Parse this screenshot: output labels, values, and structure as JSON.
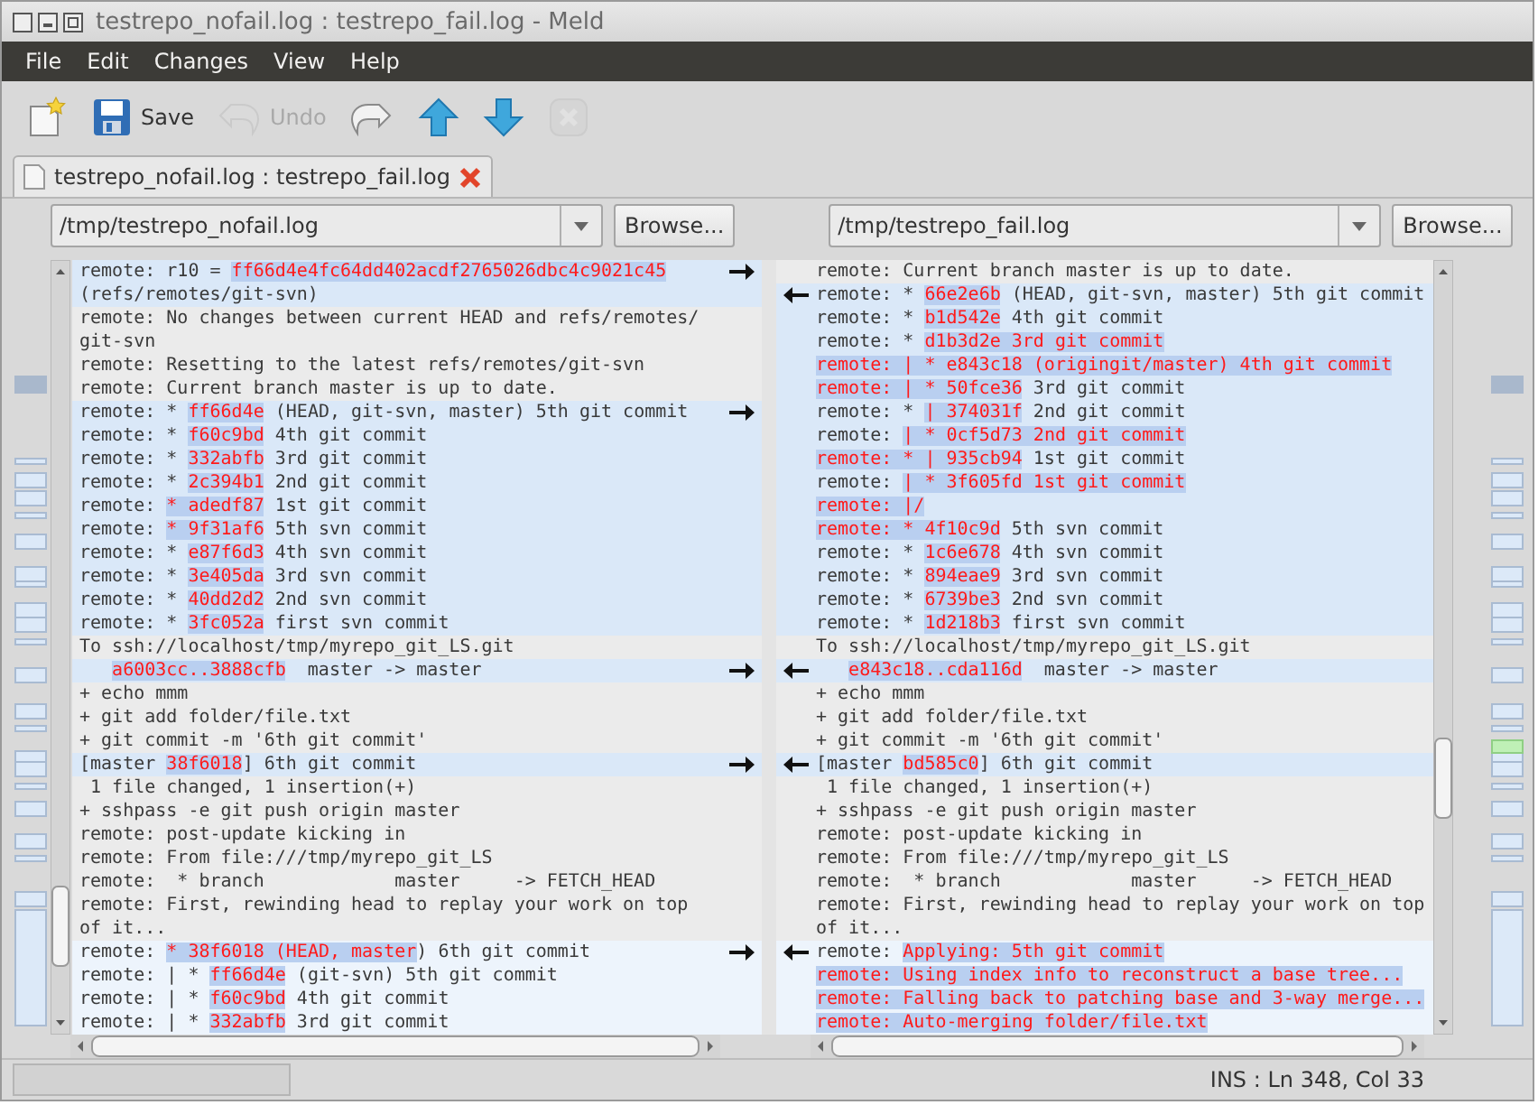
{
  "window": {
    "title": "testrepo_nofail.log : testrepo_fail.log - Meld"
  },
  "menu": [
    "File",
    "Edit",
    "Changes",
    "View",
    "Help"
  ],
  "toolbar": [
    {
      "kind": "new",
      "disabled": false
    },
    {
      "kind": "save",
      "label": "Save",
      "disabled": false
    },
    {
      "kind": "undo",
      "label": "Undo",
      "disabled": true
    },
    {
      "kind": "redo",
      "disabled": false
    },
    {
      "kind": "up",
      "disabled": false
    },
    {
      "kind": "down",
      "disabled": false
    },
    {
      "kind": "stop",
      "disabled": true
    }
  ],
  "tabs": [
    {
      "label": "testrepo_nofail.log : testrepo_fail.log",
      "selected": true
    }
  ],
  "panes": [
    {
      "path": "/tmp/testrepo_nofail.log",
      "browse": "Browse...",
      "lines": [
        {
          "kind": "changed",
          "arrow": true,
          "parts": [
            {
              "text": "remote: r10 = ",
              "changed": false
            },
            {
              "text": "ff66d4e4fc64dd402acdf2765026dbc4c9021c45",
              "changed": true
            }
          ]
        },
        {
          "kind": "changed",
          "arrow": false,
          "parts": [
            {
              "text": "(refs/remotes/git-svn)",
              "changed": false
            }
          ]
        },
        {
          "kind": "equal",
          "arrow": false,
          "parts": [
            {
              "text": "remote: No changes between current HEAD and refs/remotes/",
              "changed": false
            }
          ]
        },
        {
          "kind": "equal",
          "arrow": false,
          "parts": [
            {
              "text": "git-svn",
              "changed": false
            }
          ]
        },
        {
          "kind": "equal",
          "arrow": false,
          "parts": [
            {
              "text": "remote: Resetting to the latest refs/remotes/git-svn",
              "changed": false
            }
          ]
        },
        {
          "kind": "equal",
          "arrow": false,
          "parts": [
            {
              "text": "remote: Current branch master is up to date.",
              "changed": false
            }
          ]
        },
        {
          "kind": "changed",
          "arrow": true,
          "parts": [
            {
              "text": "remote: * ",
              "changed": false
            },
            {
              "text": "ff66d4e",
              "changed": true
            },
            {
              "text": " (HEAD, git-svn, master) 5th git commit",
              "changed": false
            }
          ]
        },
        {
          "kind": "changed",
          "arrow": false,
          "parts": [
            {
              "text": "remote: * ",
              "changed": false
            },
            {
              "text": "f60c9bd",
              "changed": true
            },
            {
              "text": " 4th git commit",
              "changed": false
            }
          ]
        },
        {
          "kind": "changed",
          "arrow": false,
          "parts": [
            {
              "text": "remote: * ",
              "changed": false
            },
            {
              "text": "332abfb",
              "changed": true
            },
            {
              "text": " 3rd git commit",
              "changed": false
            }
          ]
        },
        {
          "kind": "changed",
          "arrow": false,
          "parts": [
            {
              "text": "remote: * ",
              "changed": false
            },
            {
              "text": "2c394b1",
              "changed": true
            },
            {
              "text": " 2nd git commit",
              "changed": false
            }
          ]
        },
        {
          "kind": "changed",
          "arrow": false,
          "parts": [
            {
              "text": "remote: ",
              "changed": false
            },
            {
              "text": "* adedf87",
              "changed": true
            },
            {
              "text": " 1st git commit",
              "changed": false
            }
          ]
        },
        {
          "kind": "changed",
          "arrow": false,
          "parts": [
            {
              "text": "remote: ",
              "changed": false
            },
            {
              "text": "* 9f31af6",
              "changed": true
            },
            {
              "text": " 5th svn commit",
              "changed": false
            }
          ]
        },
        {
          "kind": "changed",
          "arrow": false,
          "parts": [
            {
              "text": "remote: * ",
              "changed": false
            },
            {
              "text": "e87f6d3",
              "changed": true
            },
            {
              "text": " 4th svn commit",
              "changed": false
            }
          ]
        },
        {
          "kind": "changed",
          "arrow": false,
          "parts": [
            {
              "text": "remote: * ",
              "changed": false
            },
            {
              "text": "3e405da",
              "changed": true
            },
            {
              "text": " 3rd svn commit",
              "changed": false
            }
          ]
        },
        {
          "kind": "changed",
          "arrow": false,
          "parts": [
            {
              "text": "remote: * ",
              "changed": false
            },
            {
              "text": "40dd2d2",
              "changed": true
            },
            {
              "text": " 2nd svn commit",
              "changed": false
            }
          ]
        },
        {
          "kind": "changed",
          "arrow": false,
          "parts": [
            {
              "text": "remote: * ",
              "changed": false
            },
            {
              "text": "3fc052a",
              "changed": true
            },
            {
              "text": " first svn commit",
              "changed": false
            }
          ]
        },
        {
          "kind": "equal",
          "arrow": false,
          "parts": [
            {
              "text": "To ssh://localhost/tmp/myrepo_git_LS.git",
              "changed": false
            }
          ]
        },
        {
          "kind": "changed",
          "arrow": true,
          "indented": true,
          "parts": [
            {
              "text": "a6003cc..3888cfb",
              "changed": true
            },
            {
              "text": "  master -> master",
              "changed": false
            }
          ]
        },
        {
          "kind": "equal",
          "arrow": false,
          "parts": [
            {
              "text": "+ echo mmm",
              "changed": false
            }
          ]
        },
        {
          "kind": "equal",
          "arrow": false,
          "parts": [
            {
              "text": "+ git add folder/file.txt",
              "changed": false
            }
          ]
        },
        {
          "kind": "equal",
          "arrow": false,
          "parts": [
            {
              "text": "+ git commit -m '6th git commit'",
              "changed": false
            }
          ]
        },
        {
          "kind": "changed",
          "arrow": true,
          "parts": [
            {
              "text": "[master ",
              "changed": false
            },
            {
              "text": "38f6018",
              "changed": true
            },
            {
              "text": "] 6th git commit",
              "changed": false
            }
          ]
        },
        {
          "kind": "equal",
          "arrow": false,
          "parts": [
            {
              "text": " 1 file changed, 1 insertion(+)",
              "changed": false
            }
          ]
        },
        {
          "kind": "equal",
          "arrow": false,
          "parts": [
            {
              "text": "+ sshpass -e git push origin master",
              "changed": false
            }
          ]
        },
        {
          "kind": "equal",
          "arrow": false,
          "parts": [
            {
              "text": "remote: post-update kicking in",
              "changed": false
            }
          ]
        },
        {
          "kind": "equal",
          "arrow": false,
          "parts": [
            {
              "text": "remote: From file:///tmp/myrepo_git_LS",
              "changed": false
            }
          ]
        },
        {
          "kind": "equal",
          "arrow": false,
          "parts": [
            {
              "text": "remote:  * branch            master     -> FETCH_HEAD",
              "changed": false
            }
          ]
        },
        {
          "kind": "equal",
          "arrow": false,
          "parts": [
            {
              "text": "remote: First, rewinding head to replay your work on top",
              "changed": false
            }
          ]
        },
        {
          "kind": "equal",
          "arrow": false,
          "parts": [
            {
              "text": "of it...",
              "changed": false
            }
          ]
        },
        {
          "kind": "inserted",
          "arrow": true,
          "parts": [
            {
              "text": "remote: ",
              "changed": false
            },
            {
              "text": "* 38f6018 (HEAD, master",
              "changed": true
            },
            {
              "text": ") 6th git commit",
              "changed": false
            }
          ]
        },
        {
          "kind": "inserted",
          "arrow": false,
          "parts": [
            {
              "text": "remote: | * ",
              "changed": false
            },
            {
              "text": "ff66d4e",
              "changed": true
            },
            {
              "text": " (git-svn) 5th git commit",
              "changed": false
            }
          ]
        },
        {
          "kind": "inserted",
          "arrow": false,
          "parts": [
            {
              "text": "remote: | * ",
              "changed": false
            },
            {
              "text": "f60c9bd",
              "changed": true
            },
            {
              "text": " 4th git commit",
              "changed": false
            }
          ]
        },
        {
          "kind": "inserted",
          "arrow": false,
          "parts": [
            {
              "text": "remote: | * ",
              "changed": false
            },
            {
              "text": "332abfb",
              "changed": true
            },
            {
              "text": " 3rd git commit",
              "changed": false
            }
          ]
        }
      ]
    },
    {
      "path": "/tmp/testrepo_fail.log",
      "browse": "Browse...",
      "lines": [
        {
          "kind": "equal",
          "arrow": false,
          "parts": [
            {
              "text": "remote: Current branch master is up to date.",
              "changed": false
            }
          ]
        },
        {
          "kind": "changed",
          "arrow": true,
          "parts": [
            {
              "text": "remote: * ",
              "changed": false
            },
            {
              "text": "66e2e6b",
              "changed": true
            },
            {
              "text": " (HEAD, git-svn, master) 5th git commit",
              "changed": false
            }
          ]
        },
        {
          "kind": "changed",
          "arrow": false,
          "parts": [
            {
              "text": "remote: * ",
              "changed": false
            },
            {
              "text": "b1d542e",
              "changed": true
            },
            {
              "text": " 4th git commit",
              "changed": false
            }
          ]
        },
        {
          "kind": "changed",
          "arrow": false,
          "parts": [
            {
              "text": "remote: * ",
              "changed": false
            },
            {
              "text": "d1b3d2e 3rd git commit",
              "changed": true
            }
          ]
        },
        {
          "kind": "changed",
          "arrow": false,
          "parts": [
            {
              "text": "remote: | * e843c18 (origingit/master) 4th git commit",
              "changed": true
            }
          ]
        },
        {
          "kind": "changed",
          "arrow": false,
          "parts": [
            {
              "text": "remote: | * 50fce36",
              "changed": true
            },
            {
              "text": " 3rd git commit",
              "changed": false
            }
          ]
        },
        {
          "kind": "changed",
          "arrow": false,
          "parts": [
            {
              "text": "remote: * ",
              "changed": false
            },
            {
              "text": "| 374031f",
              "changed": true
            },
            {
              "text": " 2nd git commit",
              "changed": false
            }
          ]
        },
        {
          "kind": "changed",
          "arrow": false,
          "parts": [
            {
              "text": "remote: ",
              "changed": false
            },
            {
              "text": "| * 0cf5d73 2nd git commit",
              "changed": true
            }
          ]
        },
        {
          "kind": "changed",
          "arrow": false,
          "parts": [
            {
              "text": "remote: * | 935cb94",
              "changed": true
            },
            {
              "text": " 1st git commit",
              "changed": false
            }
          ]
        },
        {
          "kind": "changed",
          "arrow": false,
          "parts": [
            {
              "text": "remote: ",
              "changed": false
            },
            {
              "text": "| * 3f605fd 1st git commit",
              "changed": true
            }
          ]
        },
        {
          "kind": "changed",
          "arrow": false,
          "parts": [
            {
              "text": "remote: |/",
              "changed": true
            }
          ]
        },
        {
          "kind": "changed",
          "arrow": false,
          "parts": [
            {
              "text": "remote: * 4f10c9d",
              "changed": true
            },
            {
              "text": " 5th svn commit",
              "changed": false
            }
          ]
        },
        {
          "kind": "changed",
          "arrow": false,
          "parts": [
            {
              "text": "remote: * ",
              "changed": false
            },
            {
              "text": "1c6e678",
              "changed": true
            },
            {
              "text": " 4th svn commit",
              "changed": false
            }
          ]
        },
        {
          "kind": "changed",
          "arrow": false,
          "parts": [
            {
              "text": "remote: * ",
              "changed": false
            },
            {
              "text": "894eae9",
              "changed": true
            },
            {
              "text": " 3rd svn commit",
              "changed": false
            }
          ]
        },
        {
          "kind": "changed",
          "arrow": false,
          "parts": [
            {
              "text": "remote: * ",
              "changed": false
            },
            {
              "text": "6739be3",
              "changed": true
            },
            {
              "text": " 2nd svn commit",
              "changed": false
            }
          ]
        },
        {
          "kind": "changed",
          "arrow": false,
          "parts": [
            {
              "text": "remote: * ",
              "changed": false
            },
            {
              "text": "1d218b3",
              "changed": true
            },
            {
              "text": " first svn commit",
              "changed": false
            }
          ]
        },
        {
          "kind": "equal",
          "arrow": false,
          "parts": [
            {
              "text": "To ssh://localhost/tmp/myrepo_git_LS.git",
              "changed": false
            }
          ]
        },
        {
          "kind": "changed",
          "arrow": true,
          "indented": true,
          "parts": [
            {
              "text": "e843c18..cda116d",
              "changed": true
            },
            {
              "text": "  master -> master",
              "changed": false
            }
          ]
        },
        {
          "kind": "equal",
          "arrow": false,
          "parts": [
            {
              "text": "+ echo mmm",
              "changed": false
            }
          ]
        },
        {
          "kind": "equal",
          "arrow": false,
          "parts": [
            {
              "text": "+ git add folder/file.txt",
              "changed": false
            }
          ]
        },
        {
          "kind": "equal",
          "arrow": false,
          "parts": [
            {
              "text": "+ git commit -m '6th git commit'",
              "changed": false
            }
          ]
        },
        {
          "kind": "changed",
          "arrow": true,
          "parts": [
            {
              "text": "[master ",
              "changed": false
            },
            {
              "text": "bd585c0",
              "changed": true
            },
            {
              "text": "] 6th git commit",
              "changed": false
            }
          ]
        },
        {
          "kind": "equal",
          "arrow": false,
          "parts": [
            {
              "text": " 1 file changed, 1 insertion(+)",
              "changed": false
            }
          ]
        },
        {
          "kind": "equal",
          "arrow": false,
          "parts": [
            {
              "text": "+ sshpass -e git push origin master",
              "changed": false
            }
          ]
        },
        {
          "kind": "equal",
          "arrow": false,
          "parts": [
            {
              "text": "remote: post-update kicking in",
              "changed": false
            }
          ]
        },
        {
          "kind": "equal",
          "arrow": false,
          "parts": [
            {
              "text": "remote: From file:///tmp/myrepo_git_LS",
              "changed": false
            }
          ]
        },
        {
          "kind": "equal",
          "arrow": false,
          "parts": [
            {
              "text": "remote:  * branch            master     -> FETCH_HEAD",
              "changed": false
            }
          ]
        },
        {
          "kind": "equal",
          "arrow": false,
          "parts": [
            {
              "text": "remote: First, rewinding head to replay your work on top",
              "changed": false
            }
          ]
        },
        {
          "kind": "equal",
          "arrow": false,
          "parts": [
            {
              "text": "of it...",
              "changed": false
            }
          ]
        },
        {
          "kind": "inserted",
          "arrow": true,
          "parts": [
            {
              "text": "remote: ",
              "changed": false
            },
            {
              "text": "Applying: 5th git commit",
              "changed": true
            }
          ]
        },
        {
          "kind": "inserted",
          "arrow": false,
          "parts": [
            {
              "text": "remote: Using index info to reconstruct a base tree...",
              "changed": true
            }
          ]
        },
        {
          "kind": "inserted",
          "arrow": false,
          "parts": [
            {
              "text": "remote: Falling back to patching base and 3-way merge...",
              "changed": true
            }
          ]
        },
        {
          "kind": "inserted",
          "arrow": false,
          "parts": [
            {
              "text": "remote: Auto-merging folder/file.txt",
              "changed": true
            }
          ]
        }
      ]
    }
  ],
  "status_bar": {
    "position": "INS : Ln 348, Col 33"
  }
}
